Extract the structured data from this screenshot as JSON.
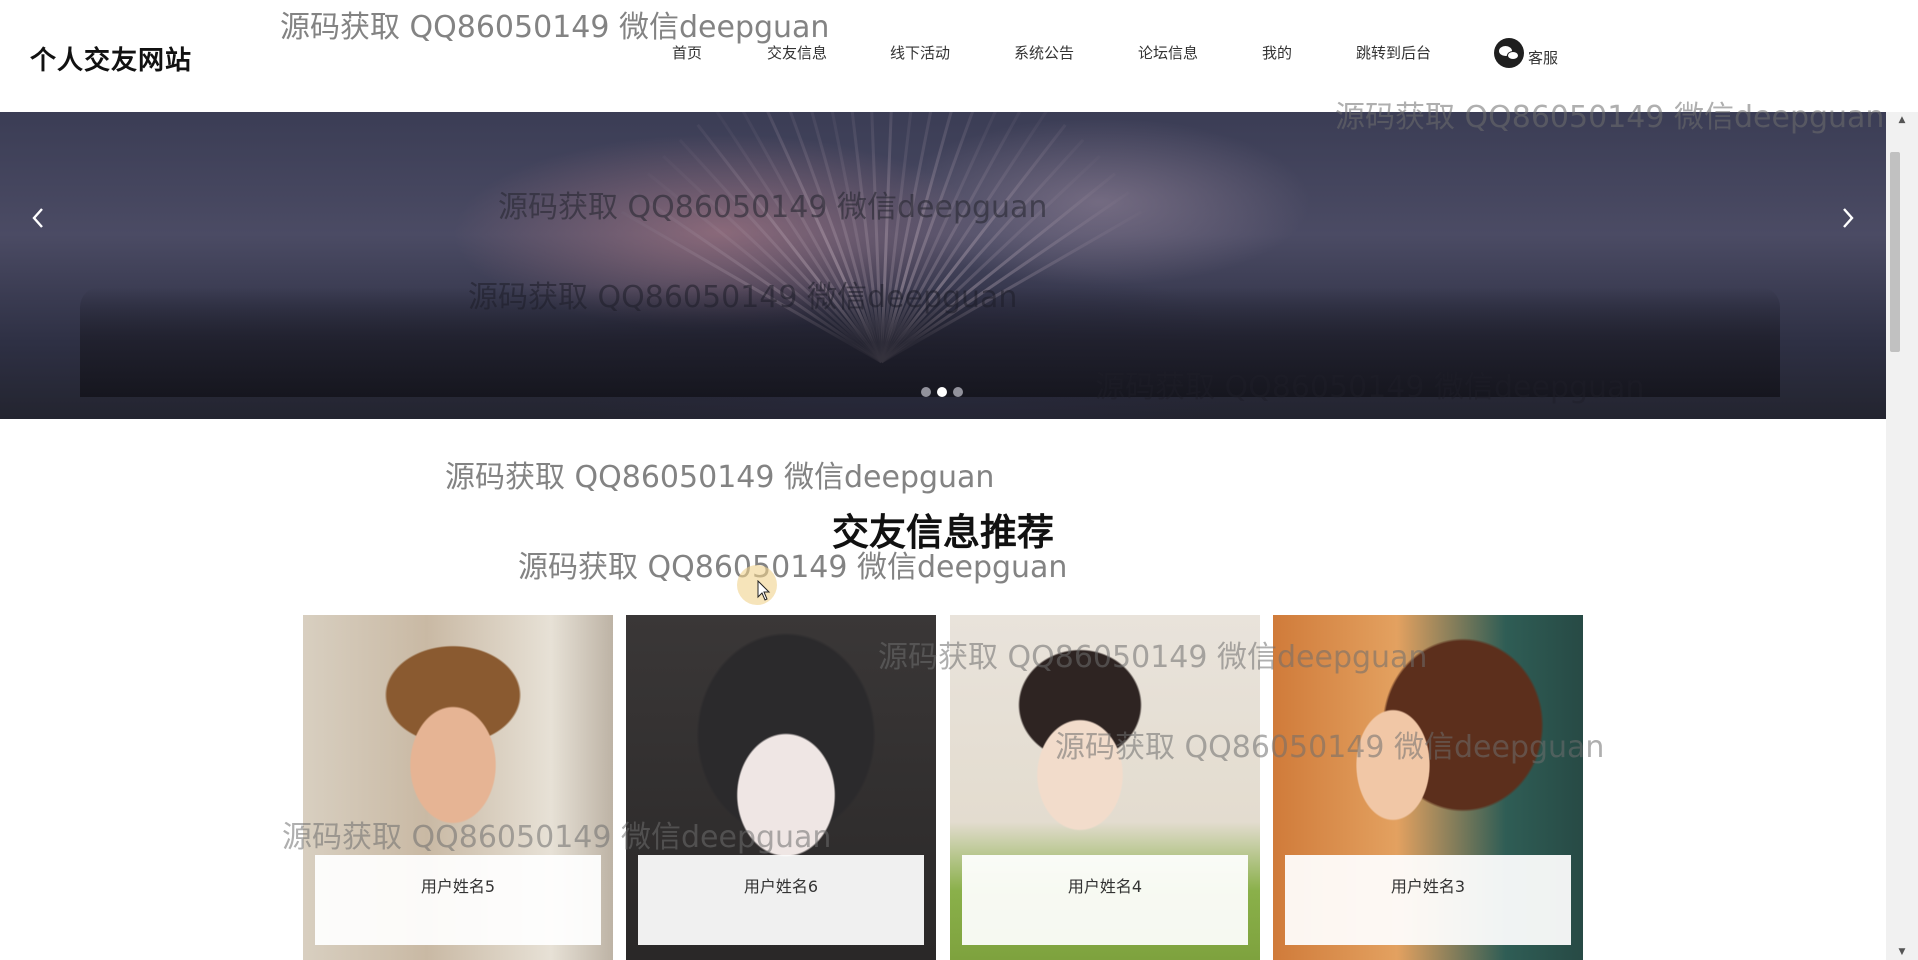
{
  "header": {
    "logo": "个人交友网站",
    "nav": [
      {
        "label": "首页"
      },
      {
        "label": "交友信息"
      },
      {
        "label": "线下活动"
      },
      {
        "label": "系统公告"
      },
      {
        "label": "论坛信息"
      },
      {
        "label": "我的"
      },
      {
        "label": "跳转到后台"
      }
    ],
    "service_label": "客服",
    "service_icon": "wechat-icon"
  },
  "banner": {
    "slide_count": 3,
    "active_slide": 2,
    "prev_icon": "chevron-left-icon",
    "next_icon": "chevron-right-icon"
  },
  "section": {
    "title": "交友信息推荐"
  },
  "cards": [
    {
      "name": "用户姓名5"
    },
    {
      "name": "用户姓名6"
    },
    {
      "name": "用户姓名4"
    },
    {
      "name": "用户姓名3"
    }
  ],
  "watermark_text": "源码获取 QQ86050149 微信deepguan",
  "colors": {
    "text": "#333333",
    "logo": "#111111",
    "background": "#ffffff"
  }
}
